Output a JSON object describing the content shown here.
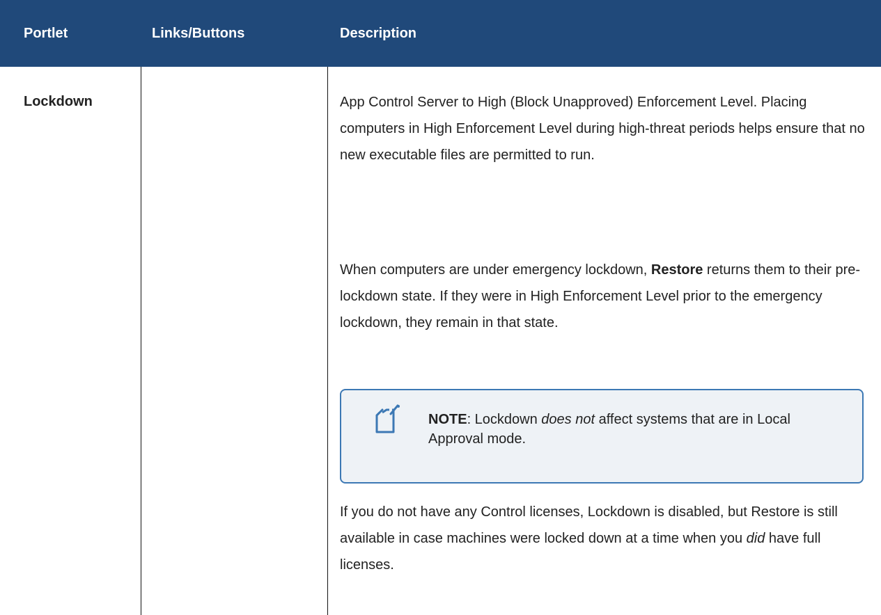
{
  "table": {
    "headers": {
      "portlet": "Portlet",
      "links_buttons": "Links/Buttons",
      "description": "Description"
    },
    "row": {
      "portlet": "Lockdown",
      "links_buttons": "",
      "description": {
        "p1": "App Control Server to High (Block Unapproved) Enforcement Level. Placing computers in High Enforcement Level during high-threat periods helps ensure that no new executable files are permitted to run.",
        "p2_before": "When computers are under emergency lockdown, ",
        "p2_bold": "Restore",
        "p2_after": " returns them to their pre-lockdown state. If they were in High Enforcement Level prior to the emergency lockdown, they remain in that state.",
        "note_label": "NOTE",
        "note_before": ": Lockdown ",
        "note_italic": "does not",
        "note_after": " affect systems that are in Local Approval mode.",
        "note_icon": "note-icon",
        "p3_before": "If you do not have any Control licenses, Lockdown is disabled, but Restore is still available in case machines were locked down at a time when you ",
        "p3_italic": "did",
        "p3_after": " have full licenses."
      }
    }
  },
  "colors": {
    "header_bg": "#20497a",
    "header_text": "#ffffff",
    "note_border": "#3c78b4",
    "note_bg": "#eef2f6"
  }
}
